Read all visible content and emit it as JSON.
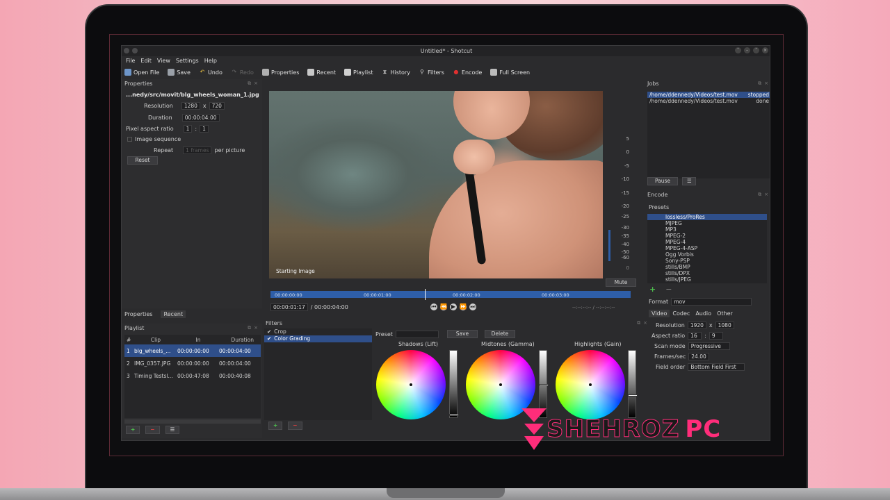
{
  "window": {
    "title": "Untitled* - Shotcut"
  },
  "menu": [
    "File",
    "Edit",
    "View",
    "Settings",
    "Help"
  ],
  "toolbar": {
    "open_file": "Open File",
    "save": "Save",
    "undo": "Undo",
    "redo": "Redo",
    "properties": "Properties",
    "recent": "Recent",
    "playlist": "Playlist",
    "history": "History",
    "filters": "Filters",
    "encode": "Encode",
    "full_screen": "Full Screen"
  },
  "properties": {
    "title": "Properties",
    "file_path": "...nedy/src/movit/blg_wheels_woman_1.jpg",
    "resolution_label": "Resolution",
    "res_w": "1280",
    "res_x": "x",
    "res_h": "720",
    "duration_label": "Duration",
    "duration": "00:00:04:00",
    "par_label": "Pixel aspect ratio",
    "par_a": "1",
    "par_sep": ":",
    "par_b": "1",
    "image_sequence": "Image sequence",
    "repeat_label": "Repeat",
    "repeat_value": "1 frames",
    "per_picture": "per picture",
    "reset": "Reset"
  },
  "tabs_bottom_left": [
    "Properties",
    "Recent"
  ],
  "viewer": {
    "label": "Starting Image"
  },
  "meter": {
    "ticks": [
      "5",
      "0",
      "-5",
      "-10",
      "-15",
      "-20",
      "-25",
      "-30",
      "-35",
      "-40",
      "-50",
      "-60",
      "0"
    ],
    "mute": "Mute"
  },
  "timeline": {
    "marks": [
      "00:00:00:00",
      "00:00:01:00",
      "00:00:02:00",
      "00:00:03:00"
    ],
    "position": "00:00:01:17",
    "total": "/ 00:00:04:00",
    "inout": "--:--:--:-- / --:--:--:--"
  },
  "jobs": {
    "title": "Jobs",
    "items": [
      {
        "path": "/home/ddennedy/Videos/test.mov",
        "status": "stopped"
      },
      {
        "path": "/home/ddennedy/Videos/test.mov",
        "status": "done"
      }
    ],
    "pause": "Pause"
  },
  "encode": {
    "title": "Encode",
    "presets_label": "Presets",
    "presets": [
      "lossless/ProRes",
      "MJPEG",
      "MP3",
      "MPEG-2",
      "MPEG-4",
      "MPEG-4-ASP",
      "Ogg Vorbis",
      "Sony-PSP",
      "stills/BMP",
      "stills/DPX",
      "stills/JPEG"
    ],
    "format_label": "Format",
    "format": "mov",
    "tabs": [
      "Video",
      "Codec",
      "Audio",
      "Other"
    ],
    "resolution_label": "Resolution",
    "res_w": "1920",
    "res_x": "x",
    "res_h": "1080",
    "aspect_label": "Aspect ratio",
    "aspect_a": "16",
    "aspect_sep": ":",
    "aspect_b": "9",
    "scan_label": "Scan mode",
    "scan": "Progressive",
    "fps_label": "Frames/sec",
    "fps": "24.00",
    "field_label": "Field order",
    "field": "Bottom Field First"
  },
  "playlist": {
    "title": "Playlist",
    "headers": [
      "#",
      "Clip",
      "In",
      "Duration"
    ],
    "rows": [
      {
        "num": "1",
        "clip": "blg_wheels_...",
        "in": "00:00:00:00",
        "dur": "00:00:04:00"
      },
      {
        "num": "2",
        "clip": "IMG_0357.JPG",
        "in": "00:00:00:00",
        "dur": "00:00:04:00"
      },
      {
        "num": "3",
        "clip": "Timing Testsl...",
        "in": "00:00:47:08",
        "dur": "00:00:40:08"
      }
    ]
  },
  "filters": {
    "title": "Filters",
    "items": [
      "Crop",
      "Color Grading"
    ],
    "preset_label": "Preset",
    "save": "Save",
    "delete": "Delete",
    "wheels": [
      "Shadows (Lift)",
      "Midtones (Gamma)",
      "Highlights (Gain)"
    ]
  },
  "watermark": {
    "text_a": "SHEHROZ",
    "text_b": "PC"
  },
  "colors": {
    "accent": "#2f4f8a",
    "watermark_pink": "#ff2d7a",
    "watermark_dark": "#1a1a1a"
  }
}
